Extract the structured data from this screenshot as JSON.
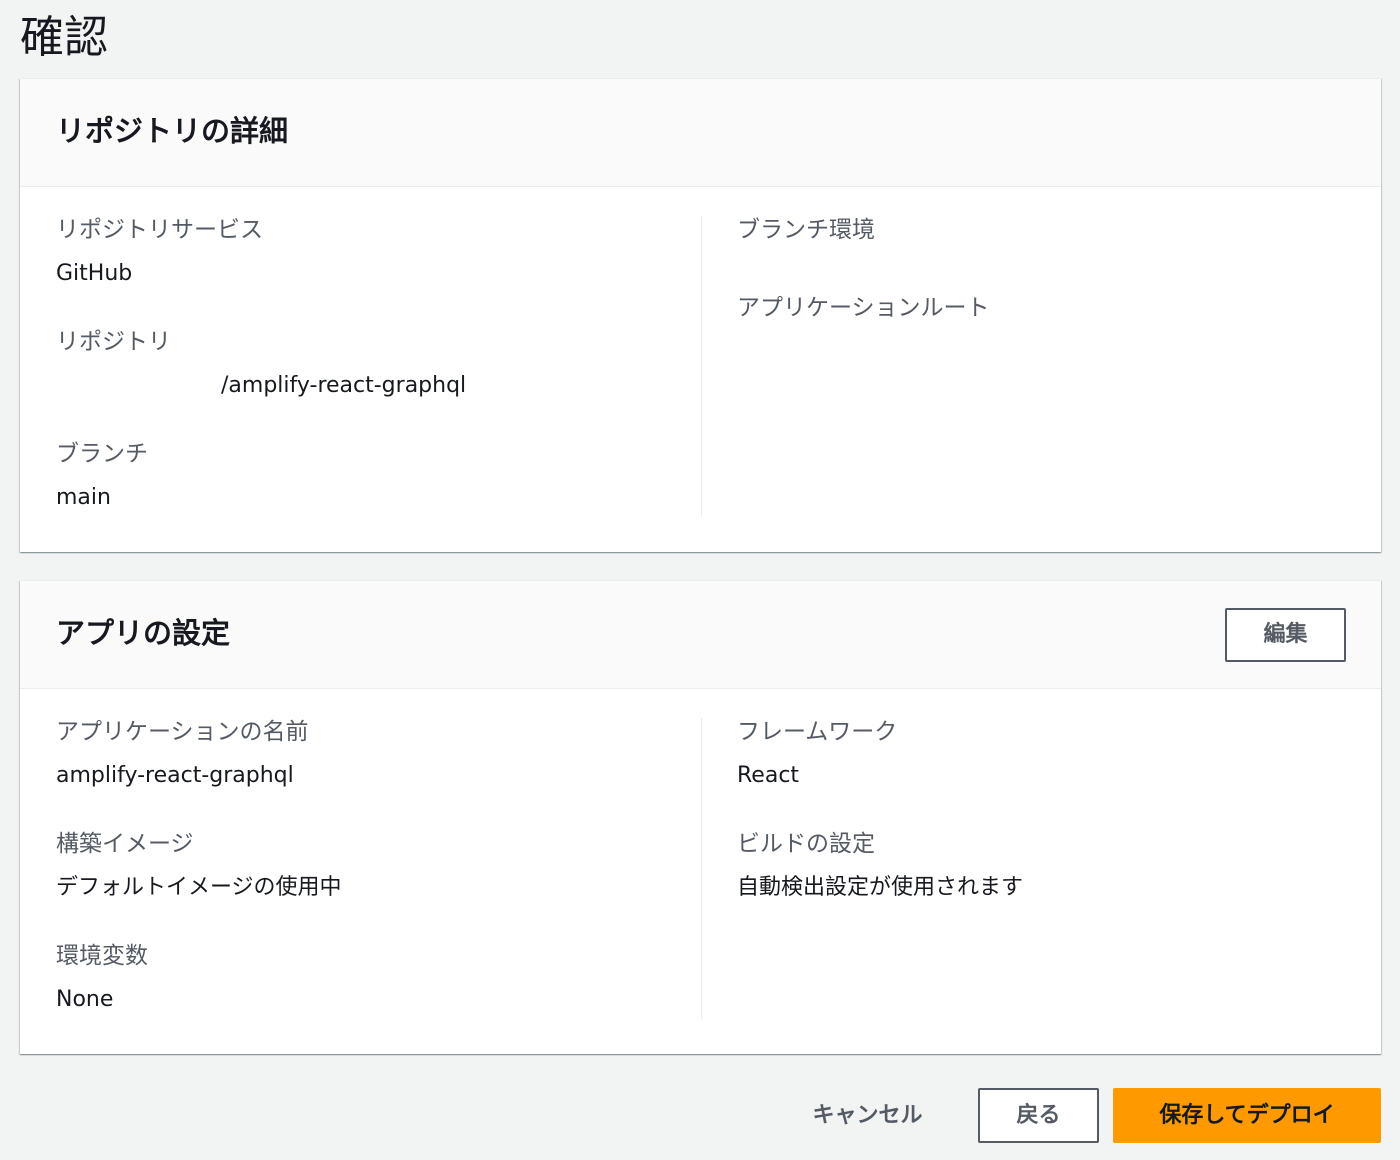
{
  "page": {
    "title": "確認"
  },
  "repository_details": {
    "title": "リポジトリの詳細",
    "left": [
      {
        "label": "リポジトリサービス",
        "value": "GitHub"
      },
      {
        "label": "リポジトリ",
        "value": "/amplify-react-graphql"
      },
      {
        "label": "ブランチ",
        "value": "main"
      }
    ],
    "right": [
      {
        "label": "ブランチ環境",
        "value": ""
      },
      {
        "label": "アプリケーションルート",
        "value": ""
      }
    ]
  },
  "app_settings": {
    "title": "アプリの設定",
    "edit_label": "編集",
    "left": [
      {
        "label": "アプリケーションの名前",
        "value": "amplify-react-graphql"
      },
      {
        "label": "構築イメージ",
        "value": "デフォルトイメージの使用中"
      },
      {
        "label": "環境変数",
        "value": "None"
      }
    ],
    "right": [
      {
        "label": "フレームワーク",
        "value": "React"
      },
      {
        "label": "ビルドの設定",
        "value": "自動検出設定が使用されます"
      }
    ]
  },
  "footer": {
    "cancel_label": "キャンセル",
    "back_label": "戻る",
    "deploy_label": "保存してデプロイ"
  },
  "colors": {
    "background": "#f2f3f3",
    "panel_header": "#fafafa",
    "primary_button": "#ff9900",
    "label_text": "#545b64",
    "value_text": "#16191f"
  }
}
